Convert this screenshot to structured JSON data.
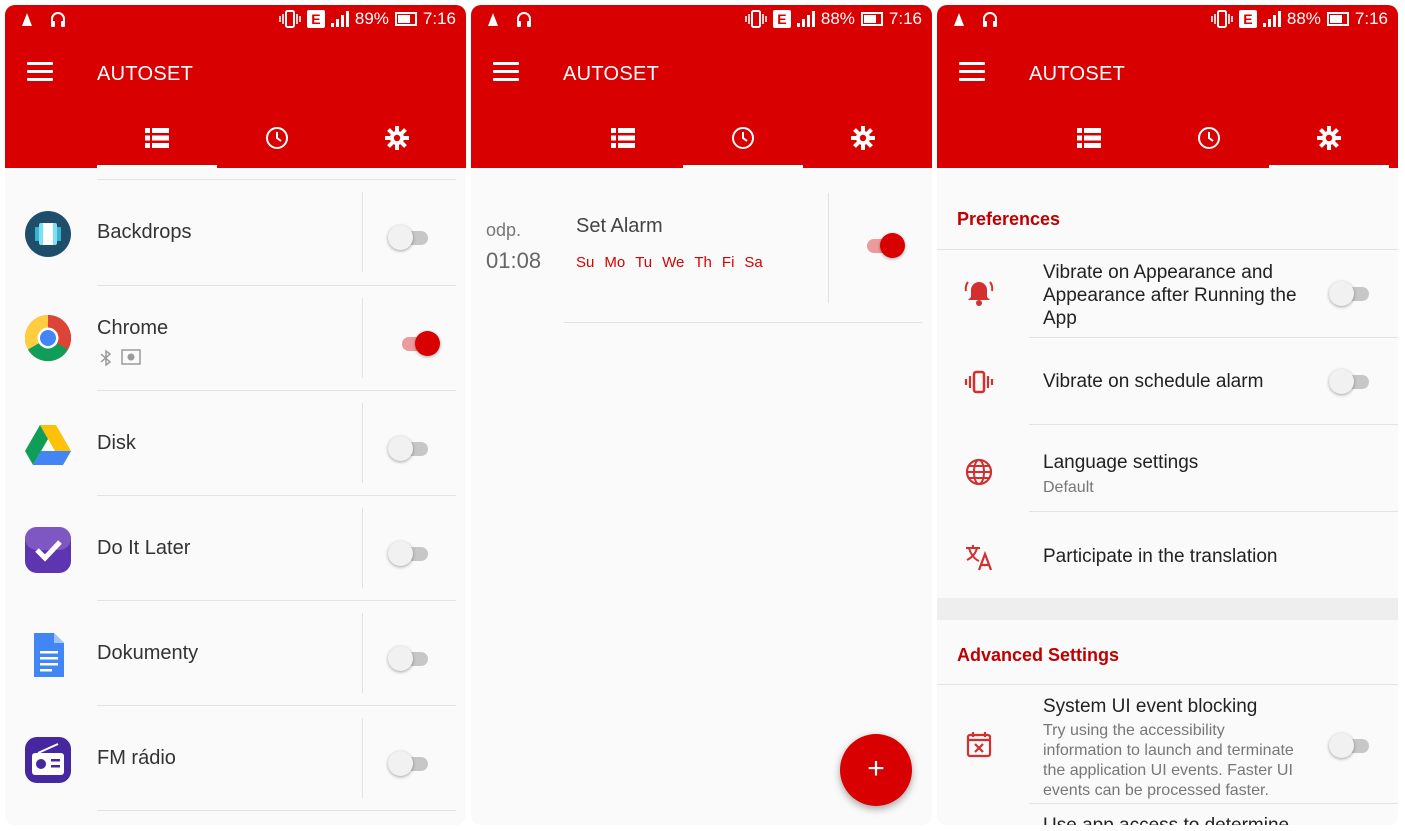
{
  "colors": {
    "accent": "#d80000",
    "accent_light": "#ef9a9a",
    "header_text": "#c00000"
  },
  "screens": [
    {
      "status": {
        "battery": "89%",
        "time": "7:16",
        "network_badge": "E"
      },
      "title": "AUTOSET",
      "active_tab": "apps",
      "apps": [
        {
          "name": "Backdrops",
          "icon": "backdrops-app-icon",
          "enabled": false
        },
        {
          "name": "Chrome",
          "icon": "chrome-app-icon",
          "enabled": true,
          "sub_icons": [
            "bluetooth-icon",
            "brightness-icon"
          ]
        },
        {
          "name": "Disk",
          "icon": "drive-app-icon",
          "enabled": false
        },
        {
          "name": "Do It Later",
          "icon": "do-it-later-app-icon",
          "enabled": false
        },
        {
          "name": "Dokumenty",
          "icon": "docs-app-icon",
          "enabled": false
        },
        {
          "name": "FM rádio",
          "icon": "fm-radio-app-icon",
          "enabled": false
        }
      ]
    },
    {
      "status": {
        "battery": "88%",
        "time": "7:16",
        "network_badge": "E"
      },
      "title": "AUTOSET",
      "active_tab": "schedule",
      "alarm": {
        "prefix": "odp.",
        "time": "01:08",
        "label": "Set Alarm",
        "days": [
          "Su",
          "Mo",
          "Tu",
          "We",
          "Th",
          "Fi",
          "Sa"
        ],
        "enabled": true
      },
      "fab_label": "+"
    },
    {
      "status": {
        "battery": "88%",
        "time": "7:16",
        "network_badge": "E"
      },
      "title": "AUTOSET",
      "active_tab": "settings",
      "preferences_header": "Preferences",
      "preferences": [
        {
          "icon": "bell-alert-icon",
          "title": "Vibrate on Appearance and Appearance after Running the App",
          "toggle": true,
          "value": false
        },
        {
          "icon": "vibrate-icon",
          "title": "Vibrate on schedule alarm",
          "toggle": true,
          "value": false
        },
        {
          "icon": "globe-icon",
          "title": "Language settings",
          "subtitle": "Default",
          "toggle": false
        },
        {
          "icon": "translate-icon",
          "title": "Participate in the translation",
          "toggle": false
        }
      ],
      "advanced_header": "Advanced Settings",
      "advanced": [
        {
          "icon": "calendar-x-icon",
          "title": "System UI event blocking",
          "subtitle": "Try using the accessibility information to launch and terminate the application UI events. Faster UI events can be processed faster.",
          "toggle": true,
          "value": false
        },
        {
          "title": "Use app access to determine"
        }
      ]
    }
  ]
}
